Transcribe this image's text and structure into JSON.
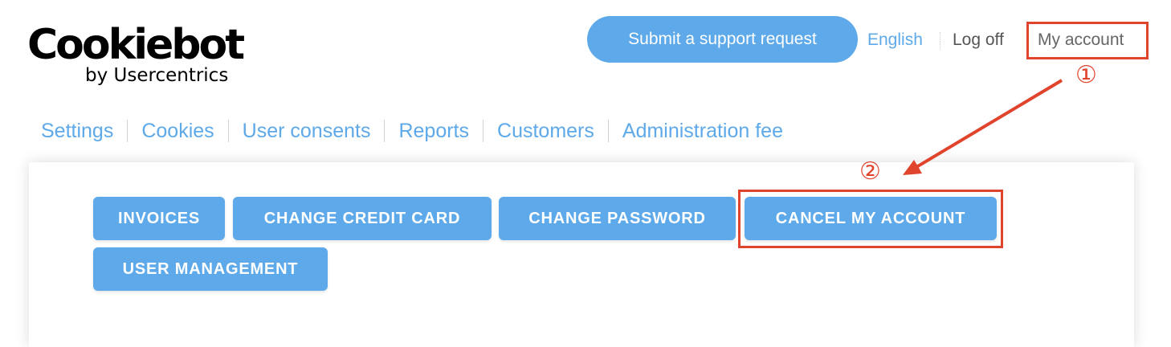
{
  "logo": {
    "name": "Cookiebot",
    "sub": "by Usercentrics"
  },
  "header": {
    "support_label": "Submit a support request",
    "language_label": "English",
    "logoff_label": "Log off",
    "my_account_label": "My account"
  },
  "nav": {
    "items": [
      {
        "label": "Settings"
      },
      {
        "label": "Cookies"
      },
      {
        "label": "User consents"
      },
      {
        "label": "Reports"
      },
      {
        "label": "Customers"
      },
      {
        "label": "Administration fee"
      }
    ]
  },
  "account_actions": {
    "invoices": "INVOICES",
    "change_credit_card": "CHANGE CREDIT CARD",
    "change_password": "CHANGE PASSWORD",
    "cancel_account": "CANCEL MY ACCOUNT",
    "user_management": "USER MANAGEMENT"
  },
  "annotations": {
    "step1": "①",
    "step2": "②",
    "color": "#e0442c"
  },
  "colors": {
    "accent": "#5da9e9",
    "annotation": "#e0442c"
  }
}
